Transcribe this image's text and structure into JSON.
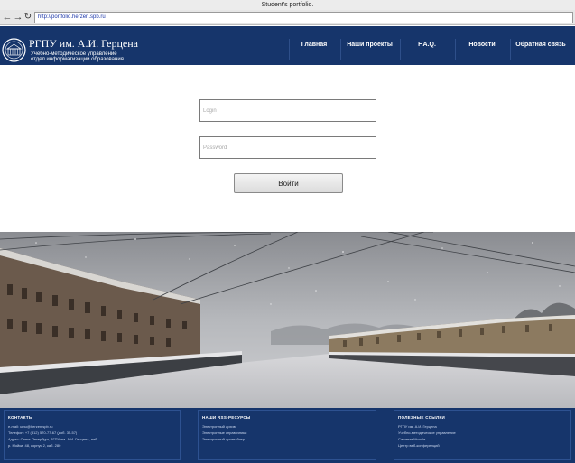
{
  "window": {
    "title": "Student's portfolio."
  },
  "browser": {
    "url": "http://portfolio.herzen.spb.ru",
    "back_icon": "arrow-left",
    "forward_icon": "arrow-right",
    "reload_icon": "reload"
  },
  "header": {
    "brand_title": "РГПУ им. А.И. Герцена",
    "brand_subtitle_1": "Учебно-методическое управление",
    "brand_subtitle_2": "отдел информатизации образования",
    "nav": [
      {
        "label": "Главная"
      },
      {
        "label": "Наши проекты"
      },
      {
        "label": "F.A.Q."
      },
      {
        "label": "Новости"
      },
      {
        "label": "Обратная связь"
      }
    ],
    "background_color": "#16356b"
  },
  "login": {
    "login_placeholder": "Login",
    "login_value": "",
    "password_placeholder": "Password",
    "password_value": "",
    "submit_label": "Войти"
  },
  "footer": {
    "contacts": {
      "heading": "КОНТАКТЫ",
      "lines": [
        "e-mail: umu@herzen.spb.ru",
        "Телефон: +7 (812) 570-77-67 (доб. 35-57)",
        "Адрес: Санкт-Петербург, РГПУ им. А.И. Герцена, наб.",
        "р. Мойки, 48, корпус 2, каб. 280"
      ]
    },
    "resources": {
      "heading": "НАШИ RSS-РЕСУРСЫ",
      "lines": [
        "Электронный архив",
        "Электронные справочники",
        "Электронный органайзер"
      ]
    },
    "links": {
      "heading": "ПОЛЕЗНЫЕ ССЫЛКИ",
      "lines": [
        "РГПУ им. А.И. Герцена",
        "Учебно-методическое управление",
        "Система Moodle",
        "Центр веб-конференций"
      ]
    }
  }
}
